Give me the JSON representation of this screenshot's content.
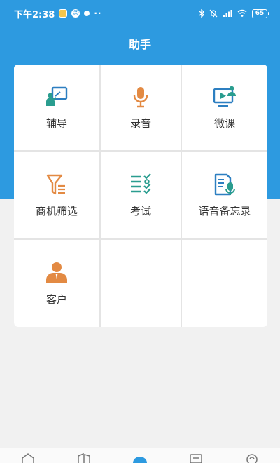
{
  "status_bar": {
    "time": "下午2:38",
    "more": "··",
    "battery": "65"
  },
  "header": {
    "title": "助手"
  },
  "grid": {
    "items": [
      {
        "label": "辅导",
        "icon": "tutor-board-icon"
      },
      {
        "label": "录音",
        "icon": "microphone-icon"
      },
      {
        "label": "微课",
        "icon": "video-lesson-icon"
      },
      {
        "label": "商机筛选",
        "icon": "funnel-filter-icon"
      },
      {
        "label": "考试",
        "icon": "checklist-icon"
      },
      {
        "label": "语音备忘录",
        "icon": "voice-memo-icon"
      },
      {
        "label": "客户",
        "icon": "customer-person-icon"
      }
    ]
  },
  "colors": {
    "header_blue": "#2d9ae0",
    "icon_teal": "#2a9d8f",
    "icon_orange": "#e38a43",
    "icon_blue": "#2d7fc1"
  }
}
